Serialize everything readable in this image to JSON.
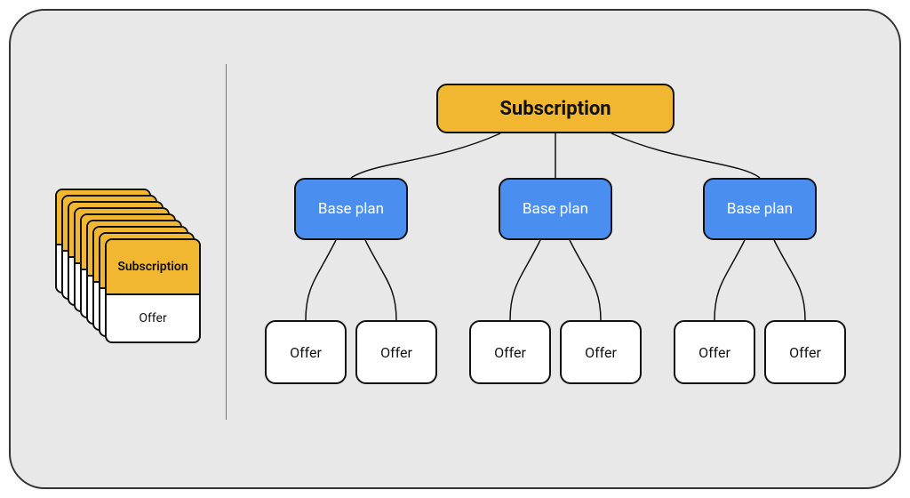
{
  "root": {
    "label": "Subscription"
  },
  "plans": [
    {
      "label": "Base plan"
    },
    {
      "label": "Base plan"
    },
    {
      "label": "Base plan"
    }
  ],
  "offers": [
    {
      "label": "Offer"
    },
    {
      "label": "Offer"
    },
    {
      "label": "Offer"
    },
    {
      "label": "Offer"
    },
    {
      "label": "Offer"
    },
    {
      "label": "Offer"
    }
  ],
  "stack": {
    "top_label": "Subscription",
    "bottom_label": "Offer",
    "count": 9
  },
  "colors": {
    "panel_bg": "#E8E8E8",
    "accent_yellow": "#F2B731",
    "accent_blue": "#4A8FF0",
    "stroke": "#111111"
  }
}
